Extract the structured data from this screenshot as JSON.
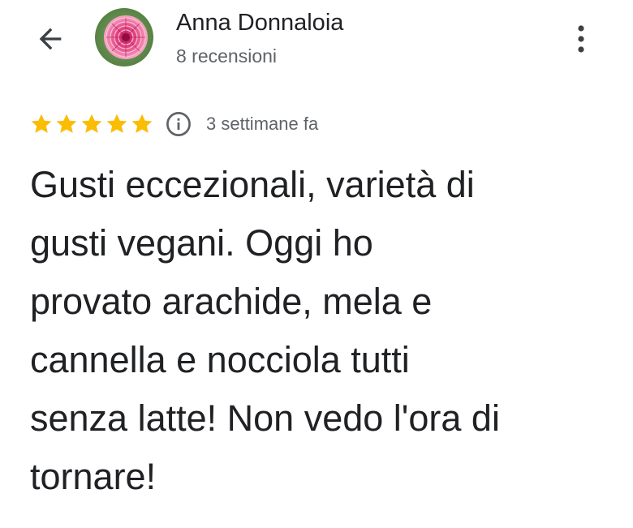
{
  "header": {
    "back_icon": "arrow-back-icon",
    "avatar_icon": "dahlia-flower-avatar",
    "author_name": "Anna Donnaloia",
    "review_count": "8 recensioni",
    "more_icon": "more-vert-icon"
  },
  "review": {
    "rating": 5,
    "rating_max": 5,
    "star_color": "#fbbc04",
    "info_icon": "info-icon",
    "date": "3 settimane fa",
    "text": "Gusti eccezionali, varietà di\ngusti vegani. Oggi ho\nprovato arachide, mela e\ncannella e nocciola tutti\nsenza latte! Non vedo l'ora di\ntornare!"
  }
}
